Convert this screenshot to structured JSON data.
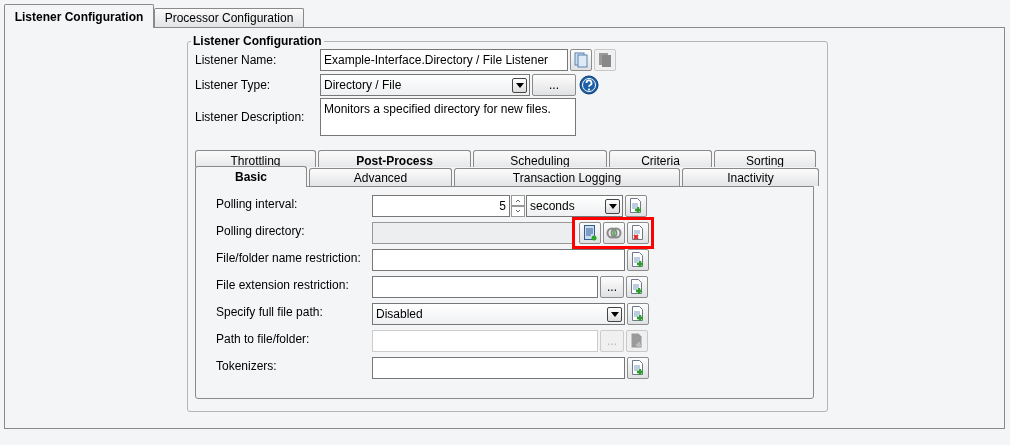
{
  "outer_tabs": [
    {
      "label": "Listener Configuration",
      "selected": true
    },
    {
      "label": "Processor Configuration",
      "selected": false
    }
  ],
  "group": {
    "title": "Listener Configuration",
    "name": {
      "label": "Listener Name:",
      "value": "Example-Interface.Directory / File Listener"
    },
    "type": {
      "label": "Listener Type:",
      "value": "Directory / File",
      "browse": "..."
    },
    "description": {
      "label": "Listener Description:",
      "value": "Monitors a specified directory for new files."
    }
  },
  "inner_tabs": [
    [
      {
        "label": "Throttling",
        "selected": false,
        "bold": false
      },
      {
        "label": "Post-Process",
        "selected": false,
        "bold": true
      },
      {
        "label": "Scheduling",
        "selected": false,
        "bold": false
      },
      {
        "label": "Criteria",
        "selected": false,
        "bold": false
      },
      {
        "label": "Sorting",
        "selected": false,
        "bold": false
      }
    ],
    [
      {
        "label": "Basic",
        "selected": true,
        "bold": true
      },
      {
        "label": "Advanced",
        "selected": false,
        "bold": false
      },
      {
        "label": "Transaction Logging",
        "selected": false,
        "bold": false
      },
      {
        "label": "Inactivity",
        "selected": false,
        "bold": false
      }
    ]
  ],
  "settings": [
    {
      "kind": "spinner",
      "label": "Polling interval:",
      "value": "5",
      "unit": "seconds"
    },
    {
      "kind": "directory",
      "label": "Polling directory:",
      "highlighted": true
    },
    {
      "kind": "text",
      "label": "File/folder name restriction:",
      "disabled": false
    },
    {
      "kind": "browse",
      "label": "File extension restriction:",
      "browse": "...",
      "disabled": false
    },
    {
      "kind": "select",
      "label": "Specify full file path:",
      "value": "Disabled"
    },
    {
      "kind": "browse",
      "label": "Path to file/folder:",
      "browse": "...",
      "disabled": true
    },
    {
      "kind": "text",
      "label": "Tokenizers:",
      "disabled": false
    }
  ]
}
